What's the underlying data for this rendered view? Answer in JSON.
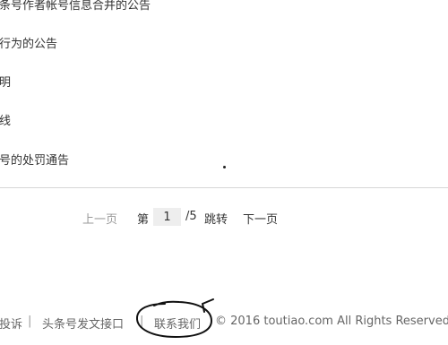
{
  "list": {
    "items": [
      {
        "label": "条号作者帐号信息合并的公告"
      },
      {
        "label": "行为的公告"
      },
      {
        "label": "明"
      },
      {
        "label": "线"
      },
      {
        "label": "号的处罚通告"
      }
    ]
  },
  "pagination": {
    "prev_label": "上一页",
    "page_prefix": "第",
    "current_page": "1",
    "total": "/5",
    "jump_label": "跳转",
    "next_label": "下一页"
  },
  "footer": {
    "complaint_label": "投诉",
    "separator": "|",
    "api_label": "头条号发文接口",
    "contact_label": "联系我们",
    "copyright": "© 2016 toutiao.com All Rights Reserved"
  },
  "colors": {
    "divider": "#d6d6d6",
    "page_input_bg": "#eeeeee",
    "annotation": "#111111"
  },
  "icons": {
    "annotation": "hand-drawn-circle"
  }
}
